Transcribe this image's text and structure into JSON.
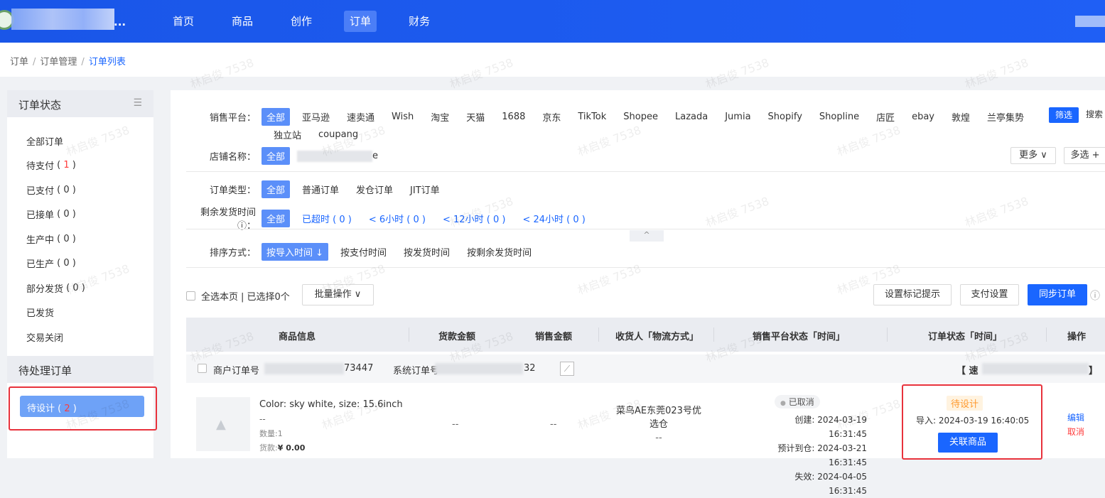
{
  "topbar": {
    "brand_suffix": "...",
    "nav": [
      "首页",
      "商品",
      "创作",
      "订单",
      "财务"
    ],
    "active_nav": 3
  },
  "breadcrumb": {
    "items": [
      "订单",
      "订单管理",
      "订单列表"
    ]
  },
  "sidebar": {
    "title": "订单状态",
    "items": [
      {
        "label": "全部订单",
        "num": ""
      },
      {
        "label": "待支付",
        "num": "1",
        "red": true
      },
      {
        "label": "已支付",
        "num": "0"
      },
      {
        "label": "已接单",
        "num": "0"
      },
      {
        "label": "生产中",
        "num": "0"
      },
      {
        "label": "已生产",
        "num": "0"
      },
      {
        "label": "部分发货",
        "num": "0"
      },
      {
        "label": "已发货",
        "num": ""
      },
      {
        "label": "交易关闭",
        "num": ""
      }
    ],
    "pending_title": "待处理订单",
    "pending_item": {
      "label": "待设计",
      "num": "2"
    }
  },
  "filters": {
    "platform_label": "销售平台：",
    "platforms_row1": [
      "全部",
      "亚马逊",
      "速卖通",
      "Wish",
      "淘宝",
      "天猫",
      "1688",
      "京东",
      "TikTok",
      "Shopee",
      "Lazada",
      "Jumia",
      "Shopify",
      "Shopline",
      "店匠",
      "ebay",
      "敦煌",
      "兰亭集势"
    ],
    "platforms_row2": [
      "独立站",
      "coupang"
    ],
    "filter_btn": "筛选",
    "search_btn": "搜索",
    "store_label": "店铺名称：",
    "store_all": "全部",
    "store_name_suffix": "e",
    "more_btn": "更多 ∨",
    "multi_btn": "多选 +",
    "type_label": "订单类型：",
    "types": [
      "全部",
      "普通订单",
      "发仓订单",
      "JIT订单"
    ],
    "remain_label": "剩余发货时间 ⓘ：",
    "remain": [
      {
        "label": "全部",
        "num": ""
      },
      {
        "label": "已超时",
        "num": "0"
      },
      {
        "label": "< 6小时",
        "num": "0"
      },
      {
        "label": "< 12小时",
        "num": "0"
      },
      {
        "label": "< 24小时",
        "num": "0"
      }
    ],
    "sort_label": "排序方式：",
    "sorts": [
      "按导入时间 ↓",
      "按支付时间",
      "按发货时间",
      "按剩余发货时间"
    ]
  },
  "toolbar": {
    "select_page": "全选本页",
    "selected": "| 已选择0个",
    "batch": "批量操作 ∨",
    "mark_tip": "设置标记提示",
    "pay_setting": "支付设置",
    "sync": "同步订单"
  },
  "table": {
    "headers": [
      "商品信息",
      "货款金额",
      "销售金额",
      "收货人「物流方式」",
      "销售平台状态「时间」",
      "订单状态「时间」",
      "操作"
    ],
    "order": {
      "merchant_label": "商户订单号",
      "merchant_suffix": "73447",
      "system_label": "系统订单号",
      "system_suffix": "32",
      "bracket_left": "【 速",
      "bracket_right": "】"
    },
    "item": {
      "spec": "Color: sky white, size: 15.6inch",
      "dash": "--",
      "qty": "数量:1",
      "pay_label": "货款:",
      "pay_value": "¥ 0.00",
      "goods_amount": "--",
      "sale_amount": "--",
      "receiver_line1": "菜鸟AE东莞023号优",
      "receiver_line2": "选仓",
      "receiver_line3": "--",
      "platform_status": "已取消",
      "created": "创建: 2024-03-19 16:31:45",
      "eta": "预计到仓: 2024-03-21 16:31:45",
      "expire": "失效: 2024-04-05 16:31:45",
      "order_status": "待设计",
      "import_time": "导入: 2024-03-19 16:40:05",
      "link_btn": "关联商品",
      "edit": "编辑",
      "cancel": "取消"
    }
  },
  "watermark": "林启俊 7538"
}
